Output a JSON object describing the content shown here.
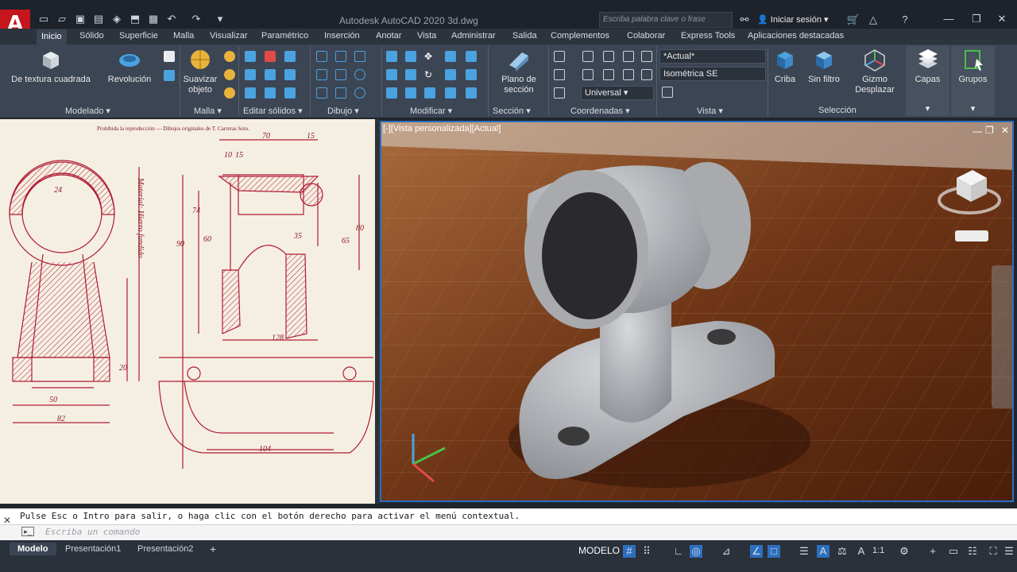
{
  "app": {
    "title": "Autodesk AutoCAD 2020    3d.dwg",
    "logo_letter": "A"
  },
  "search": {
    "placeholder": "Escriba palabra clave o frase"
  },
  "account": {
    "signin": "Iniciar sesión"
  },
  "tabs": [
    "Inicio",
    "Sólido",
    "Superficie",
    "Malla",
    "Visualizar",
    "Paramétrico",
    "Inserción",
    "Anotar",
    "Vista",
    "Administrar",
    "Salida",
    "Complementos",
    "Colaborar",
    "Express Tools",
    "Aplicaciones destacadas"
  ],
  "ribbon": {
    "modelado": {
      "label": "Modelado",
      "box_label": "De textura cuadrada",
      "revolve_label": "Revolución"
    },
    "malla": {
      "label": "Malla",
      "smooth_label": "Suavizar objeto"
    },
    "editar": {
      "label": "Editar sólidos"
    },
    "dibujo": {
      "label": "Dibujo"
    },
    "modificar": {
      "label": "Modificar"
    },
    "seccion": {
      "label": "Sección",
      "plane_label": "Plano de sección"
    },
    "coordenadas": {
      "label": "Coordenadas",
      "ucs_value": "Universal"
    },
    "vista": {
      "label": "Vista",
      "visual_style": "*Actual*",
      "view": "Isométrica SE"
    },
    "seleccion": {
      "label": "Selección",
      "cull_label": "Criba",
      "filter_label": "Sin filtro",
      "gizmo_label": "Gizmo Desplazar"
    },
    "capas": {
      "label": "Capas"
    },
    "grupos": {
      "label": "Grupos"
    }
  },
  "drawing": {
    "header": "Prohibida la reproducción — Dibujos originales de T. Carreras Soto.",
    "material": "Material: Hierro fundido",
    "dims": [
      "70",
      "15",
      "10",
      "15",
      "24",
      "82",
      "50",
      "128",
      "20",
      "104",
      "90",
      "74",
      "60",
      "35",
      "65",
      "80"
    ]
  },
  "viewport": {
    "label": "[-][Vista personalizada][Actual]"
  },
  "command": {
    "history": "Pulse Esc o Intro para salir, o haga clic con el botón derecho para activar el menú contextual.",
    "placeholder": "Escriba un comando"
  },
  "layout_tabs": [
    "Modelo",
    "Presentación1",
    "Presentación2"
  ],
  "status": {
    "mode": "MODELO",
    "scale": "1:1"
  }
}
